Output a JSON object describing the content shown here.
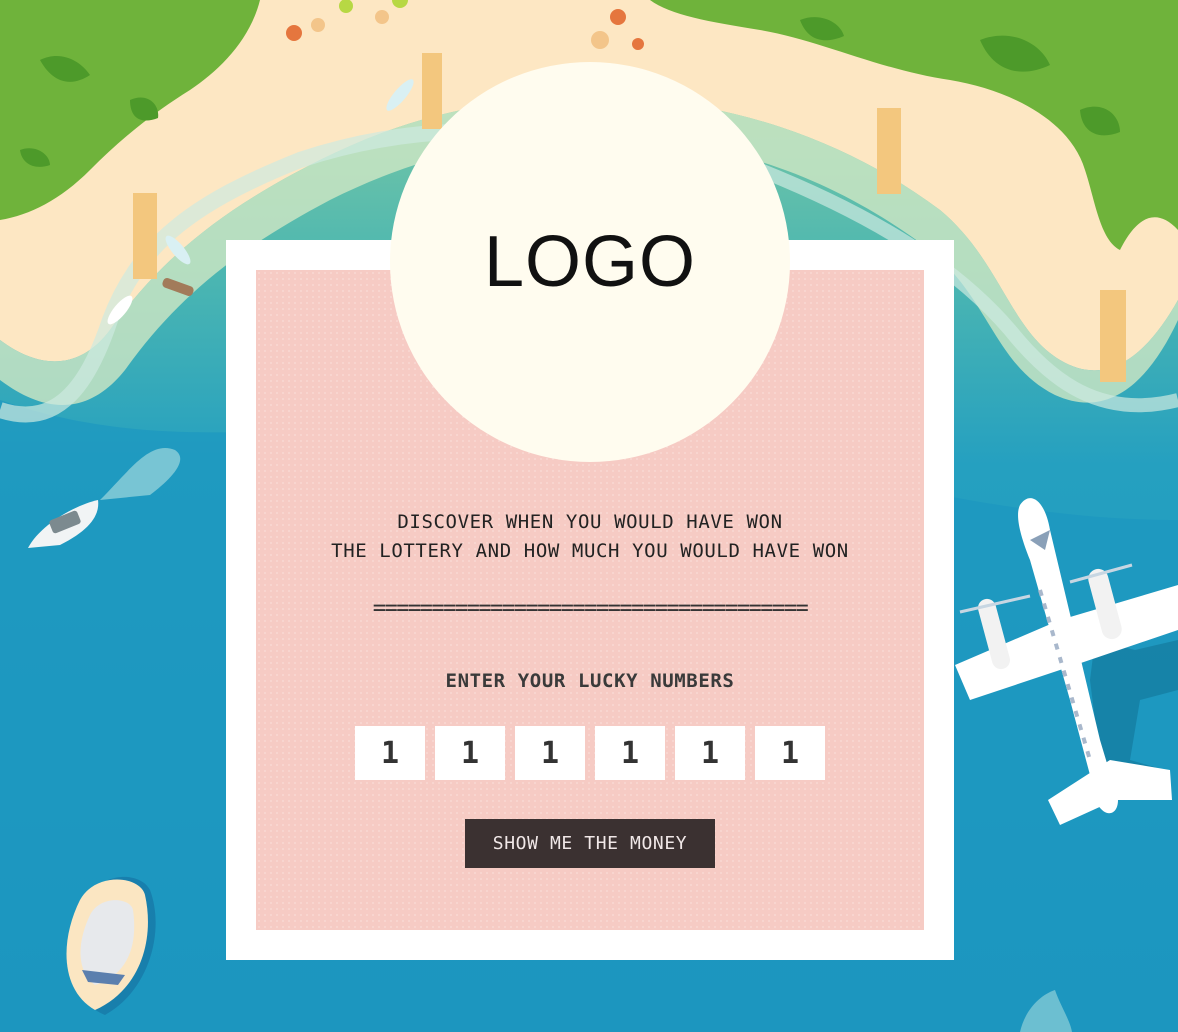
{
  "logo": {
    "text": "LOGO"
  },
  "headline": {
    "line1": "DISCOVER WHEN YOU WOULD HAVE WON",
    "line2": "THE LOTTERY AND HOW MUCH YOU WOULD HAVE WON"
  },
  "divider": "=====================================",
  "form": {
    "prompt": "ENTER YOUR LUCKY NUMBERS",
    "numbers": [
      "1",
      "1",
      "1",
      "1",
      "1",
      "1"
    ],
    "submit_label": "SHOW ME THE MONEY"
  },
  "colors": {
    "sea": "#1b97bf",
    "sand": "#fde7c3",
    "forest": "#6fb33b",
    "card_bg": "#f6cbc4",
    "button_bg": "#3b3131",
    "logo_circle": "#fffcef"
  }
}
